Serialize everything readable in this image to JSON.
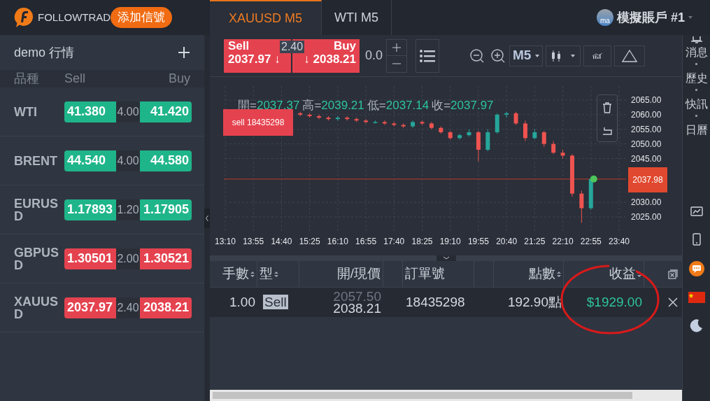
{
  "header": {
    "brand": "FOLLOWTRAD",
    "signal_button": "添加信號",
    "tabs": [
      {
        "label": "XAUUSD M5",
        "selected": true
      },
      {
        "label": "WTI M5",
        "selected": false
      }
    ],
    "account": {
      "avatar": "ma",
      "name": "模擬賬戶 #1"
    }
  },
  "quotes": {
    "title": "demo 行情",
    "columns": [
      "品種",
      "Sell",
      "Buy"
    ],
    "rows": [
      {
        "symbol": "WTI",
        "sell": "41.380",
        "spread": "4.00",
        "buy": "41.420",
        "color": "#1fb58a"
      },
      {
        "symbol": "BRENT",
        "sell": "44.540",
        "spread": "4.00",
        "buy": "44.580",
        "color": "#1fb58a"
      },
      {
        "symbol": "EURUSD",
        "sell": "1.17893",
        "spread": "1.20",
        "buy": "1.17905",
        "color": "#1fb58a"
      },
      {
        "symbol": "GBPUSD",
        "sell": "1.30501",
        "spread": "2.00",
        "buy": "1.30521",
        "color": "#e5424f"
      },
      {
        "symbol": "XAUUSD",
        "sell": "2037.97",
        "spread": "2.40",
        "buy": "2038.21",
        "color": "#e5424f"
      }
    ]
  },
  "trade_bar": {
    "sell_label": "Sell",
    "sell_price": "2037.97",
    "sell_arrow": "↓",
    "spread": "2.40",
    "buy_label": "Buy",
    "buy_price": "2038.21",
    "buy_arrow": "↓",
    "lot": "0.0",
    "timeframe": "M5"
  },
  "chart": {
    "ohlc": [
      {
        "label": "開=",
        "value": "2037.37"
      },
      {
        "label": "高=",
        "value": "2039.21"
      },
      {
        "label": "低=",
        "value": "2037.14"
      },
      {
        "label": "收=",
        "value": "2037.97"
      }
    ],
    "order_label": "sell 18435298",
    "current_price": "2037.98",
    "chart_data": {
      "type": "candlestick",
      "ylim": [
        2019.5,
        2069.8
      ],
      "grid": true,
      "ref_lines": [
        {
          "axis": "y",
          "value": 2037.98,
          "color": "#a2392f"
        }
      ],
      "categories": [
        "13:10",
        null,
        null,
        "13:55",
        null,
        null,
        "14:40",
        null,
        null,
        "15:25",
        null,
        null,
        "16:10",
        null,
        null,
        "16:55",
        null,
        null,
        "17:40",
        null,
        null,
        "18:25",
        null,
        null,
        "19:10",
        null,
        null,
        "19:55",
        null,
        null,
        "20:40",
        null,
        null,
        "21:25",
        null,
        null,
        "22:10",
        null,
        null,
        "22:55",
        null,
        null,
        "23:40"
      ],
      "yticks": [
        {
          "value": 2065,
          "label": "2065.00"
        },
        {
          "value": 2060,
          "label": "2060.00"
        },
        {
          "value": 2055,
          "label": "2055.00"
        },
        {
          "value": 2050,
          "label": "2050.00"
        },
        {
          "value": 2045,
          "label": "2045.00"
        },
        {
          "value": 2030,
          "label": "2030.00"
        },
        {
          "value": 2025,
          "label": "2025.00"
        }
      ],
      "ohlc": [
        null,
        null,
        null,
        null,
        null,
        null,
        null,
        null,
        [
          2060.5,
          2061,
          2059.5,
          2060
        ],
        [
          2060,
          2060.5,
          2059,
          2059.5
        ],
        [
          2059.5,
          2060,
          2058.5,
          2059
        ],
        [
          2059,
          2059.5,
          2058,
          2058.5
        ],
        [
          2058.5,
          2059.5,
          2058,
          2059
        ],
        [
          2059,
          2059.5,
          2058,
          2058.5
        ],
        [
          2058.5,
          2059,
          2057.5,
          2058
        ],
        [
          2058,
          2058.5,
          2057,
          2057.5
        ],
        [
          2057.5,
          2058,
          2057,
          2057.5
        ],
        [
          2057.5,
          2058,
          2056.5,
          2057
        ],
        [
          2057,
          2057.5,
          2056,
          2056.5
        ],
        [
          2056.5,
          2057,
          2055.5,
          2056
        ],
        [
          2056,
          2058,
          2055.5,
          2057.5
        ],
        [
          2057.5,
          2058,
          2056.5,
          2057
        ],
        [
          2057,
          2057.5,
          2055,
          2055.5
        ],
        [
          2055.5,
          2056,
          2053.5,
          2054
        ],
        [
          2054,
          2054.5,
          2051.5,
          2052
        ],
        [
          2052,
          2053.5,
          2051.5,
          2053
        ],
        [
          2053,
          2055,
          2052.5,
          2054
        ],
        [
          2054,
          2054.5,
          2044,
          2048
        ],
        [
          2048,
          2055,
          2047.5,
          2054
        ],
        [
          2054,
          2060.5,
          2053.5,
          2060
        ],
        [
          2060,
          2061,
          2059,
          2060.5
        ],
        [
          2060.5,
          2061,
          2056.5,
          2057
        ],
        [
          2057,
          2058,
          2051,
          2052
        ],
        [
          2052,
          2055,
          2051.5,
          2054
        ],
        [
          2054,
          2054.5,
          2049,
          2050
        ],
        [
          2050,
          2051,
          2046.5,
          2047
        ],
        [
          2047,
          2048,
          2045,
          2046
        ],
        [
          2046,
          2046.5,
          2032,
          2033
        ],
        [
          2033,
          2034,
          2023,
          2028
        ],
        [
          2028,
          2038.5,
          2027.5,
          2038
        ],
        null,
        null,
        null
      ]
    }
  },
  "positions": {
    "columns": [
      {
        "label": "手數",
        "sortable": true
      },
      {
        "label": "型",
        "sortable": true
      },
      {
        "label": "開/現價",
        "sortable": false
      },
      {
        "label": "訂單號",
        "sortable": false
      },
      {
        "label": "點數",
        "sortable": true
      },
      {
        "label": "收益",
        "sortable": true
      }
    ],
    "rows": [
      {
        "lots": "1.00",
        "type": "Sell",
        "open": "2057.50",
        "current": "2038.21",
        "order": "18435298",
        "points": "192.90點",
        "profit": "$1929.00",
        "profitable": true
      }
    ]
  },
  "side_menu": [
    {
      "label": "消息"
    },
    {
      "label": "歷史"
    },
    {
      "label": "快訊"
    },
    {
      "label": "日曆"
    }
  ]
}
